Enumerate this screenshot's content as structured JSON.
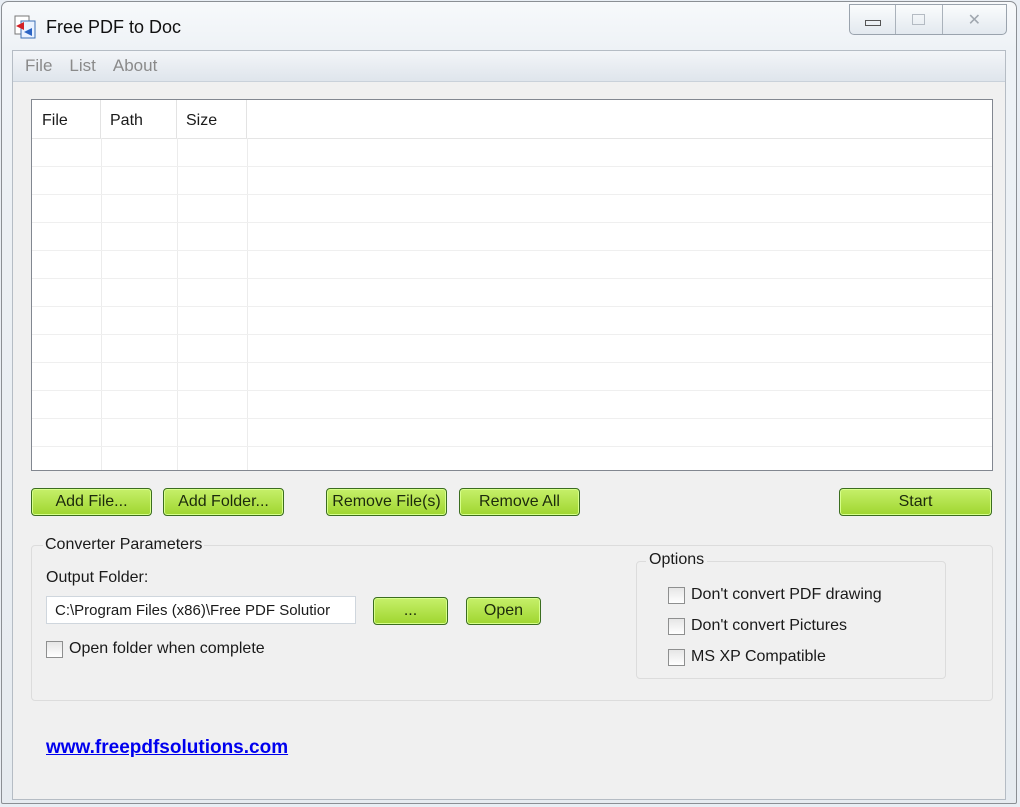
{
  "window": {
    "title": "Free PDF to Doc"
  },
  "menu": {
    "items": [
      "File",
      "List",
      "About"
    ]
  },
  "file_list": {
    "columns": [
      "File",
      "Path",
      "Size"
    ],
    "rows": []
  },
  "buttons": {
    "add_file": "Add File...",
    "add_folder": "Add Folder...",
    "remove_files": "Remove File(s)",
    "remove_all": "Remove All",
    "start": "Start",
    "browse": "...",
    "open": "Open"
  },
  "converter": {
    "group_label": "Converter Parameters",
    "output_folder_label": "Output Folder:",
    "output_folder_value": "C:\\Program Files (x86)\\Free PDF Solutior",
    "open_when_complete_label": "Open folder when complete",
    "open_when_complete_checked": false
  },
  "options": {
    "group_label": "Options",
    "items": [
      {
        "label": "Don't convert PDF drawing",
        "checked": false
      },
      {
        "label": "Don't convert Pictures",
        "checked": false
      },
      {
        "label": "MS XP Compatible",
        "checked": false
      }
    ]
  },
  "footer": {
    "link": "www.freepdfsolutions.com"
  },
  "colors": {
    "button_green": "#a8dc3a",
    "link_blue": "#0000ee"
  }
}
